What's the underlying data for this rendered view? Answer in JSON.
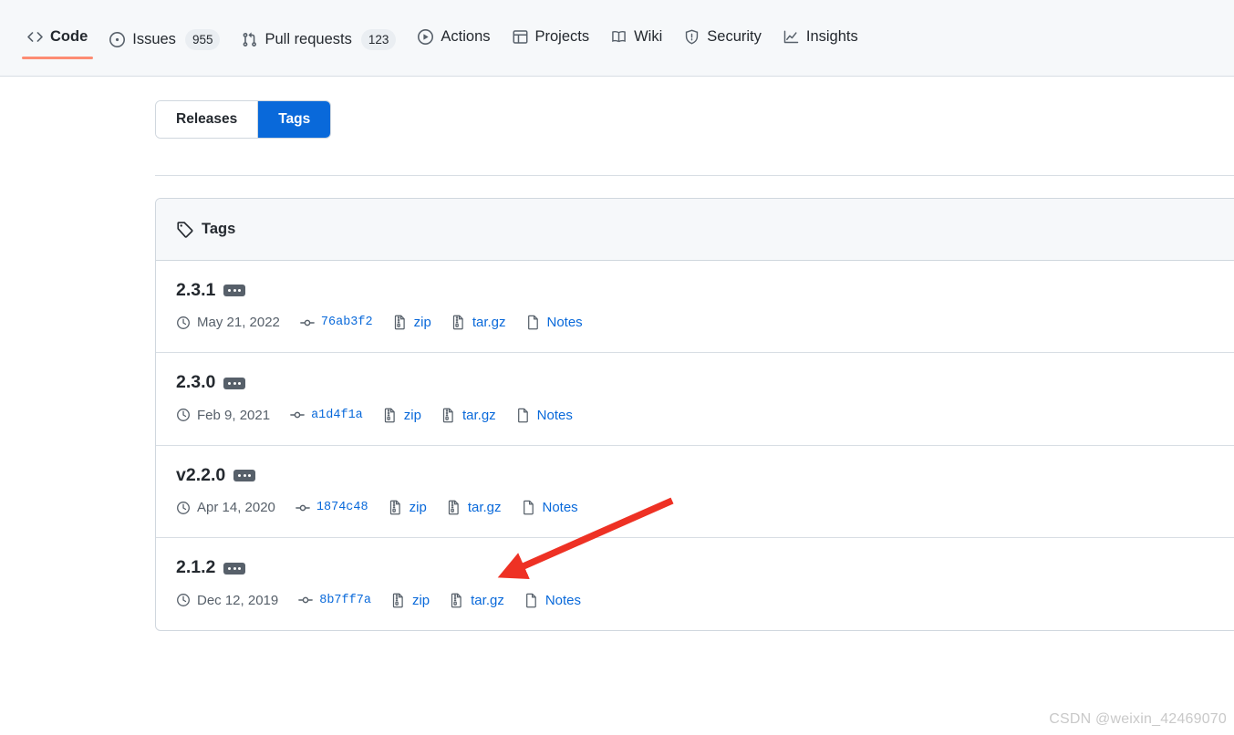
{
  "repo_nav": {
    "items": [
      {
        "label": "Code",
        "icon": "code-icon",
        "count": null,
        "selected": true
      },
      {
        "label": "Issues",
        "icon": "issue-opened-icon",
        "count": "955",
        "selected": false
      },
      {
        "label": "Pull requests",
        "icon": "git-pull-request-icon",
        "count": "123",
        "selected": false
      },
      {
        "label": "Actions",
        "icon": "play-icon",
        "count": null,
        "selected": false
      },
      {
        "label": "Projects",
        "icon": "table-icon",
        "count": null,
        "selected": false
      },
      {
        "label": "Wiki",
        "icon": "book-icon",
        "count": null,
        "selected": false
      },
      {
        "label": "Security",
        "icon": "shield-icon",
        "count": null,
        "selected": false
      },
      {
        "label": "Insights",
        "icon": "graph-icon",
        "count": null,
        "selected": false
      }
    ]
  },
  "segmented": {
    "releases_label": "Releases",
    "tags_label": "Tags",
    "active": "Tags"
  },
  "tags_box": {
    "header_title": "Tags",
    "header_icon": "tag-icon",
    "rows": [
      {
        "name": "2.3.1",
        "badge": "ellipsis-badge",
        "date": "May 21, 2022",
        "commit": "76ab3f2",
        "zip_label": "zip",
        "targz_label": "tar.gz",
        "notes_label": "Notes"
      },
      {
        "name": "2.3.0",
        "badge": "ellipsis-badge",
        "date": "Feb 9, 2021",
        "commit": "a1d4f1a",
        "zip_label": "zip",
        "targz_label": "tar.gz",
        "notes_label": "Notes"
      },
      {
        "name": "v2.2.0",
        "badge": "ellipsis-badge",
        "date": "Apr 14, 2020",
        "commit": "1874c48",
        "zip_label": "zip",
        "targz_label": "tar.gz",
        "notes_label": "Notes"
      },
      {
        "name": "2.1.2",
        "badge": "ellipsis-badge",
        "date": "Dec 12, 2019",
        "commit": "8b7ff7a",
        "zip_label": "zip",
        "targz_label": "tar.gz",
        "notes_label": "Notes"
      }
    ]
  },
  "annotation": {
    "type": "arrow",
    "color": "#ee3124",
    "points_at": "tar.gz link of v2.2.0 row"
  },
  "watermark": {
    "text": "CSDN @weixin_42469070"
  },
  "colors": {
    "accent_blue": "#0969da",
    "nav_underline": "#fd8c73",
    "nav_background": "#f6f8fa",
    "border": "#d0d7de",
    "muted_text": "#57606a",
    "annotation_red": "#ee3124"
  }
}
